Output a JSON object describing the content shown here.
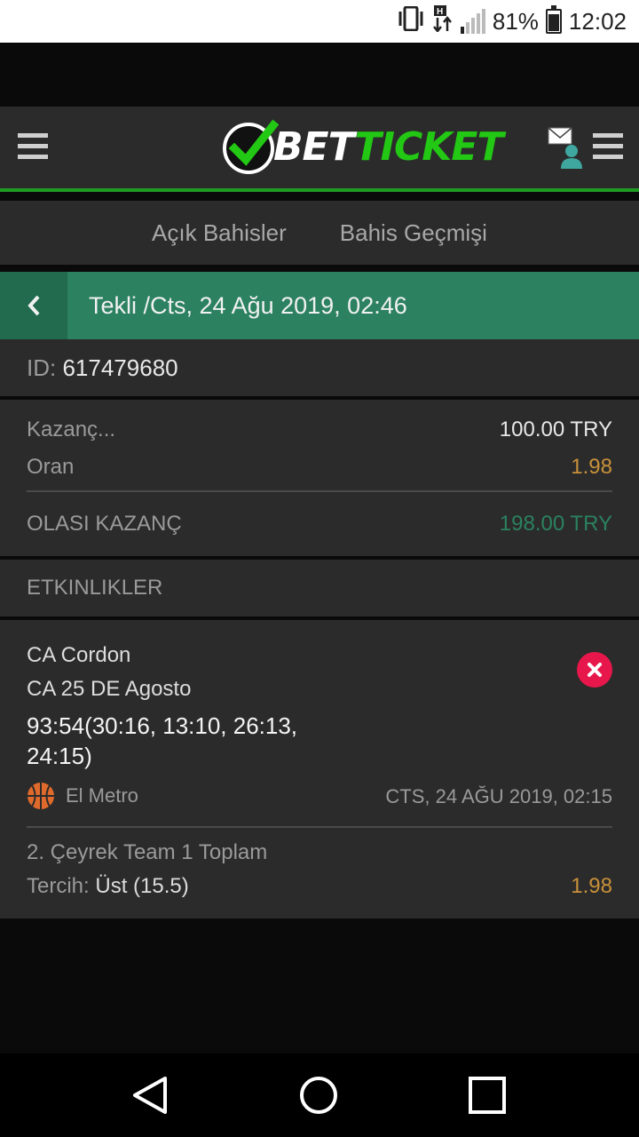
{
  "status_bar": {
    "battery": "81%",
    "time": "12:02",
    "battery_level": 0.81,
    "icons": [
      "vibrate-icon",
      "data-transfer-icon",
      "signal-icon",
      "battery-icon"
    ]
  },
  "header": {
    "logo_bet": "BET",
    "logo_ticket": "TICKET",
    "brand_color": "#22c814",
    "icons": [
      "hamburger-icon",
      "checkmark-logo-icon",
      "user-mail-icon",
      "hamburger-icon"
    ]
  },
  "tabs": [
    {
      "label": "Açık Bahisler"
    },
    {
      "label": "Bahis Geçmişi"
    }
  ],
  "bet": {
    "title": "Tekli /Cts, 24 Ağu 2019, 02:46",
    "id_label": "ID:",
    "id_value": "617479680",
    "stake_label": "Kazanç...",
    "stake_value": "100.00 TRY",
    "odds_label": "Oran",
    "odds_value": "1.98",
    "potential_label": "OLASI KAZANÇ",
    "potential_value": "198.00 TRY"
  },
  "events_header": "ETKINLIKLER",
  "event": {
    "team1": "CA Cordon",
    "team2": "CA 25 DE Agosto",
    "score": "93:54(30:16, 13:10, 26:13, 24:15)",
    "league": "El Metro",
    "date": "CTS, 24 AĞU 2019, 02:15",
    "market": "2. Çeyrek Team 1 Toplam",
    "pick_label": "Tercih:",
    "pick_value": "Üst (15.5)",
    "pick_odds": "1.98",
    "status": "lost"
  },
  "colors": {
    "header_green": "#2b8160",
    "win_green": "#2b8160",
    "odds_gold": "#c9913a",
    "lost_red": "#e8174b",
    "basketball_orange": "#e06a2c"
  }
}
